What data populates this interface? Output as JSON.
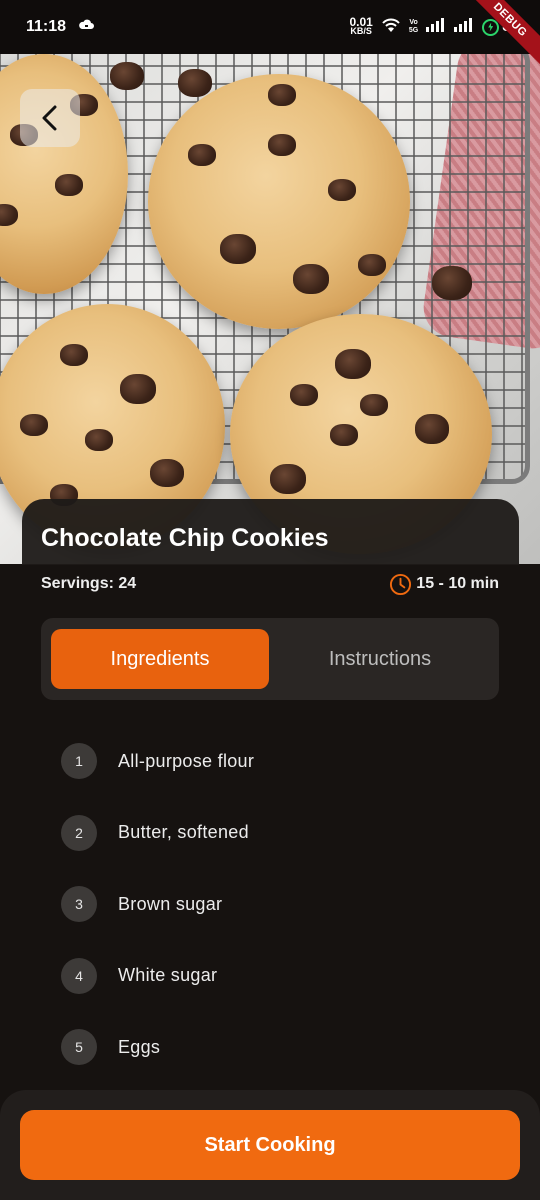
{
  "status_bar": {
    "time": "11:18",
    "net_speed_value": "0.01",
    "net_speed_unit": "KB/S",
    "volte_top": "Vo",
    "volte_bottom": "5G",
    "battery": "89",
    "debug_label": "DEBUG"
  },
  "recipe": {
    "title": "Chocolate Chip Cookies",
    "servings": "Servings: 24",
    "time": "15 - 10 min"
  },
  "tabs": [
    {
      "label": "Ingredients",
      "active": true
    },
    {
      "label": "Instructions",
      "active": false
    }
  ],
  "ingredients": [
    {
      "number": "1",
      "name": "All-purpose flour"
    },
    {
      "number": "2",
      "name": "Butter, softened"
    },
    {
      "number": "3",
      "name": "Brown sugar"
    },
    {
      "number": "4",
      "name": "White sugar"
    },
    {
      "number": "5",
      "name": "Eggs"
    }
  ],
  "actions": {
    "start_label": "Start Cooking"
  },
  "colors": {
    "accent": "#f06a10",
    "background": "#161210",
    "tab_active": "#e8620e"
  },
  "icons": {
    "back": "chevron-left-icon",
    "time": "clock-icon"
  }
}
